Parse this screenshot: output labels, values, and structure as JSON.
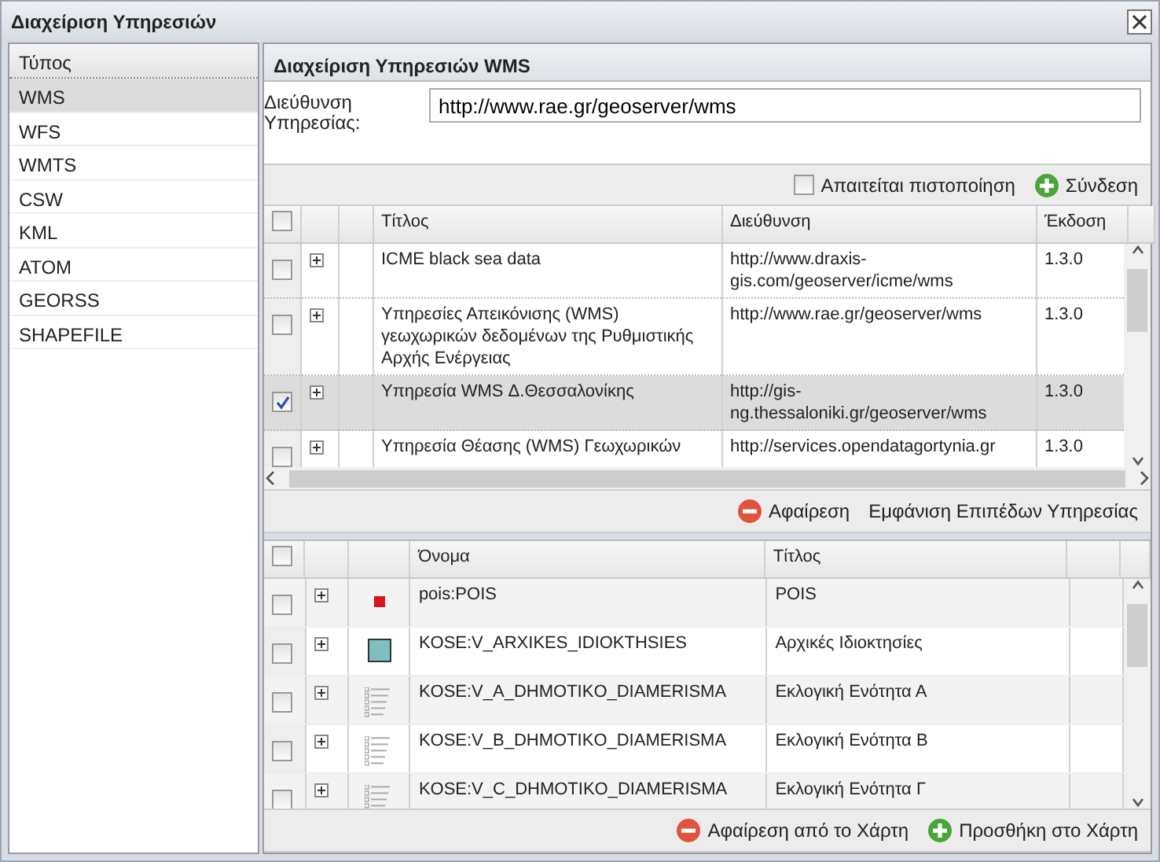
{
  "window": {
    "title": "Διαχείριση Υπηρεσιών"
  },
  "sidebar": {
    "heading": "Τύπος",
    "items": [
      {
        "label": "WMS",
        "selected": true
      },
      {
        "label": "WFS",
        "selected": false
      },
      {
        "label": "WMTS",
        "selected": false
      },
      {
        "label": "CSW",
        "selected": false
      },
      {
        "label": "KML",
        "selected": false
      },
      {
        "label": "ATOM",
        "selected": false
      },
      {
        "label": "GEORSS",
        "selected": false
      },
      {
        "label": "SHAPEFILE",
        "selected": false
      }
    ]
  },
  "panel": {
    "title": "Διαχείριση Υπηρεσιών WMS",
    "url_label": "Διεύθυνση Υπηρεσίας:",
    "url_value": "http://www.rae.gr/geoserver/wms",
    "auth": {
      "label": "Απαιτείται πιστοποίηση",
      "checked": false
    },
    "connect_button": "Σύνδεση"
  },
  "services": {
    "columns": [
      "Τίτλος",
      "Διεύθυνση",
      "Έκδοση"
    ],
    "all_checked": false,
    "rows": [
      {
        "title": "ICME black sea data",
        "address": "http://www.draxis-gis.com/geoserver/icme/wms",
        "version": "1.3.0",
        "selected": false
      },
      {
        "title": "Υπηρεσίες Απεικόνισης (WMS) γεωχωρικών δεδομένων της Ρυθμιστικής Αρχής Ενέργειας",
        "address": "http://www.rae.gr/geoserver/wms",
        "version": "1.3.0",
        "selected": false
      },
      {
        "title": "Υπηρεσία WMS Δ.Θεσσαλονίκης",
        "address": "http://gis-ng.thessaloniki.gr/geoserver/wms",
        "version": "1.3.0",
        "selected": true
      },
      {
        "title": "Υπηρεσία Θέασης (WMS) Γεωχωρικών",
        "address": "http://services.opendatagortynia.gr",
        "version": "1.3.0",
        "selected": false
      }
    ],
    "actions": [
      {
        "kind": "remove",
        "label": "Αφαίρεση"
      },
      {
        "kind": "plain",
        "label": "Εμφάνιση Επιπέδων Υπηρεσίας"
      }
    ]
  },
  "layers": {
    "columns": [
      "Όνομα",
      "Τίτλος"
    ],
    "all_checked": false,
    "rows": [
      {
        "name": "pois:POIS",
        "title": "POIS",
        "kind": "point",
        "selected": false
      },
      {
        "name": "KOSE:V_ARXIKES_IDIOKTHSIES",
        "title": "Αρχικές Ιδιοκτησίες",
        "kind": "polygon",
        "selected": false
      },
      {
        "name": "KOSE:V_A_DHMOTIKO_DIAMERISMA",
        "title": "Εκλογική Ενότητα Α",
        "kind": "legend",
        "selected": false
      },
      {
        "name": "KOSE:V_B_DHMOTIKO_DIAMERISMA",
        "title": "Εκλογική Ενότητα Β",
        "kind": "legend",
        "selected": false
      },
      {
        "name": "KOSE:V_C_DHMOTIKO_DIAMERISMA",
        "title": "Εκλογική Ενότητα Γ",
        "kind": "legend",
        "selected": false
      }
    ],
    "actions": [
      {
        "kind": "remove",
        "label": "Αφαίρεση από το Χάρτη"
      },
      {
        "kind": "add",
        "label": "Προσθήκη στο Χάρτη"
      }
    ]
  }
}
